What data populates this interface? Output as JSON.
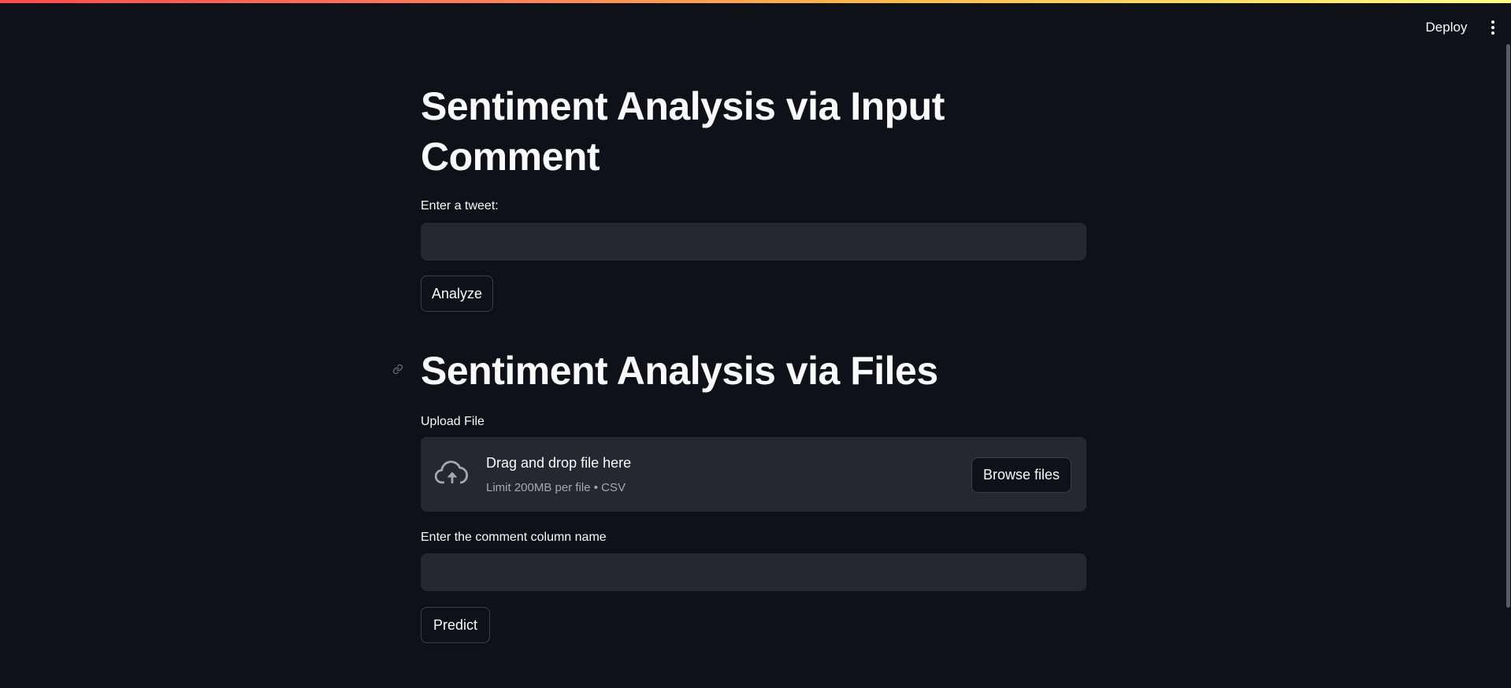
{
  "header": {
    "deploy_label": "Deploy",
    "menu_icon": "vertical-ellipsis-icon"
  },
  "section_input": {
    "title": "Sentiment Analysis via Input Comment",
    "tweet_label": "Enter a tweet:",
    "tweet_value": "",
    "analyze_label": "Analyze"
  },
  "section_files": {
    "title": "Sentiment Analysis via Files",
    "anchor_icon": "link-icon",
    "upload_label": "Upload File",
    "dropzone": {
      "icon": "cloud-upload-icon",
      "title": "Drag and drop file here",
      "subtitle": "Limit 200MB per file • CSV",
      "browse_label": "Browse files"
    },
    "column_label": "Enter the comment column name",
    "column_value": "",
    "predict_label": "Predict"
  },
  "colors": {
    "background": "#0e1117",
    "input_background": "#262730",
    "text": "#fafafa",
    "muted_text": "#a3a8b4",
    "border": "#3d3f48"
  }
}
